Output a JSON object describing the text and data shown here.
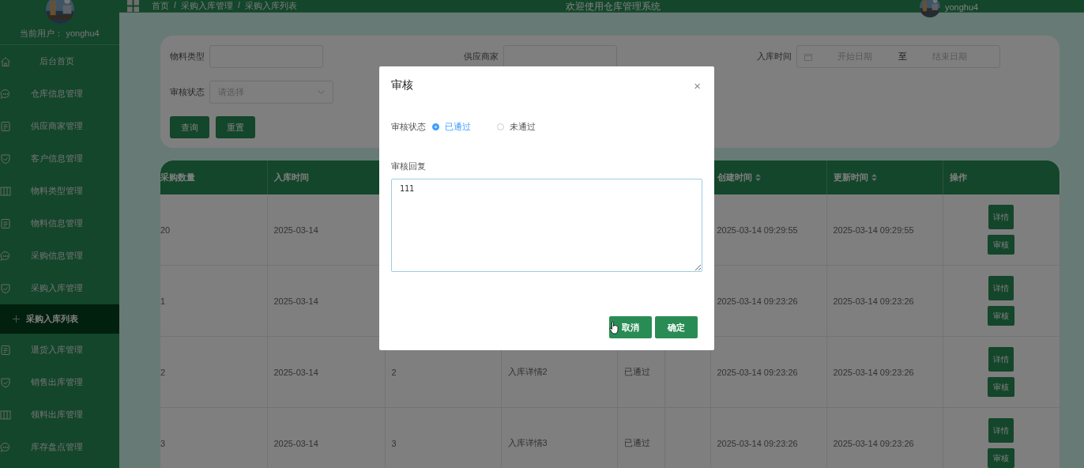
{
  "sidebar": {
    "user_label": "当前用户：",
    "username": "yonghu4",
    "items": [
      {
        "label": "后台首页",
        "kind": "home",
        "selected": false
      },
      {
        "label": "仓库信息管理",
        "kind": "chat",
        "selected": false
      },
      {
        "label": "供应商家管理",
        "kind": "doc",
        "selected": false
      },
      {
        "label": "客户信息管理",
        "kind": "shield",
        "selected": false
      },
      {
        "label": "物料类型管理",
        "kind": "columns",
        "selected": false
      },
      {
        "label": "物料信息管理",
        "kind": "doc",
        "selected": false
      },
      {
        "label": "采购信息管理",
        "kind": "chat",
        "selected": false
      },
      {
        "label": "采购入库管理",
        "kind": "shield",
        "selected": false,
        "children": [
          {
            "label": "采购入库列表",
            "selected": true
          }
        ]
      },
      {
        "label": "退货入库管理",
        "kind": "doc",
        "selected": false
      },
      {
        "label": "销售出库管理",
        "kind": "shield",
        "selected": false
      },
      {
        "label": "领料出库管理",
        "kind": "columns",
        "selected": false
      },
      {
        "label": "库存盘点管理",
        "kind": "chat",
        "selected": false
      }
    ]
  },
  "header": {
    "breadcrumb": [
      {
        "kind": "link",
        "text": "首页"
      },
      {
        "kind": "separator",
        "text": "/"
      },
      {
        "kind": "link",
        "text": "采购入库管理"
      },
      {
        "kind": "separator",
        "text": "/"
      },
      {
        "kind": "link",
        "text": "采购入库列表"
      }
    ],
    "title": "欢迎使用仓库管理系统",
    "username": "yonghu4"
  },
  "search": {
    "fields": [
      {
        "label": "物料类型",
        "kind": "text"
      },
      {
        "label": "供应商家",
        "kind": "text"
      },
      {
        "label": "入库时间",
        "kind": "daterange",
        "start_placeholder": "开始日期",
        "separator": "至",
        "end_placeholder": "结束日期"
      },
      {
        "label": "审核状态",
        "kind": "select",
        "placeholder": "请选择"
      }
    ],
    "buttons": [
      "查询",
      "重置"
    ]
  },
  "table": {
    "columns": [
      {
        "label": "采购数量",
        "sortable": false
      },
      {
        "label": "入库时间",
        "sortable": false
      },
      {},
      {},
      {},
      {},
      {
        "label": "创建时间",
        "sortable": true
      },
      {
        "label": "更新时间",
        "sortable": true
      },
      {
        "label": "操作",
        "sortable": false
      }
    ],
    "rows": [
      {
        "cells": [
          "20",
          "2025-03-14",
          null,
          null,
          null,
          null,
          "2025-03-14 09:29:55",
          "2025-03-14 09:29:55"
        ],
        "actions": [
          "详情",
          "审核"
        ]
      },
      {
        "cells": [
          "1",
          "2025-03-14",
          null,
          null,
          null,
          null,
          "2025-03-14 09:23:26",
          "2025-03-14 09:23:26"
        ],
        "actions": [
          "详情",
          "审核"
        ]
      },
      {
        "cells": [
          "2",
          "2025-03-14",
          "2",
          "入库详情2",
          "已通过",
          "",
          "2025-03-14 09:23:26",
          "2025-03-14 09:23:26"
        ],
        "actions": [
          "详情",
          "审核"
        ]
      },
      {
        "cells": [
          "3",
          "2025-03-14",
          "3",
          "入库详情3",
          "已通过",
          "",
          "2025-03-14 09:23:26",
          "2025-03-14 09:23:26"
        ],
        "actions": [
          "详情",
          "审核"
        ]
      }
    ]
  },
  "dialog": {
    "title": "审核",
    "close": "×",
    "status_label": "审核状态",
    "options": [
      {
        "label": "已通过",
        "selected": true
      },
      {
        "label": "未通过",
        "selected": false
      }
    ],
    "reply_label": "审核回复",
    "reply_value": "111",
    "buttons": [
      "取消",
      "确定"
    ]
  }
}
